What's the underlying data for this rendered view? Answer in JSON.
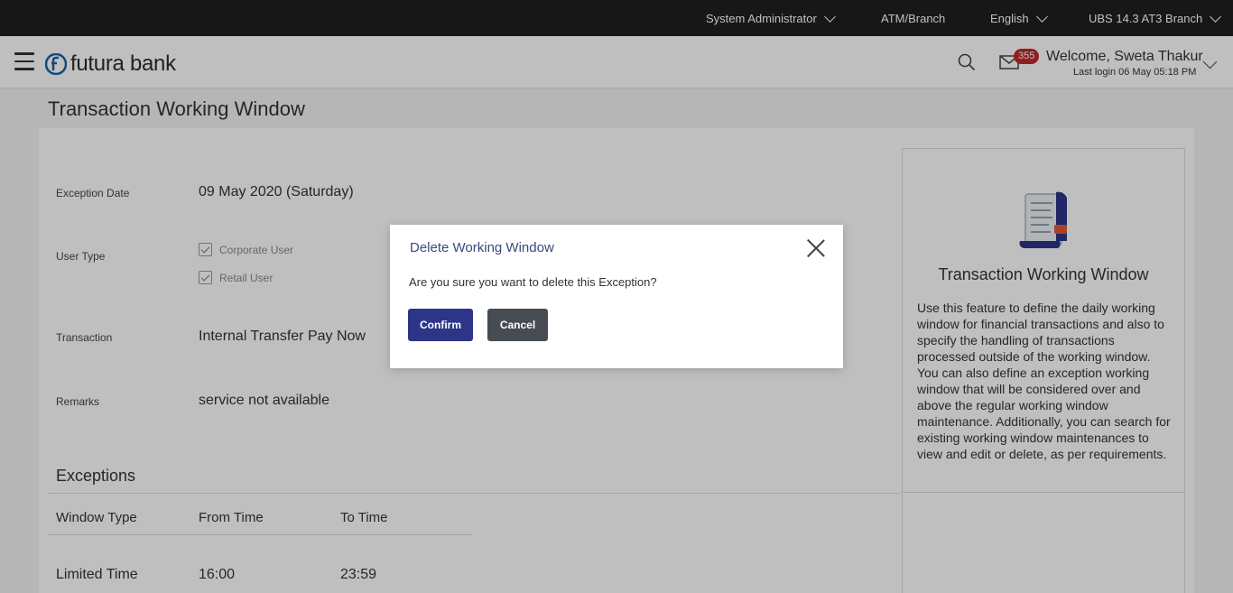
{
  "topbar": {
    "role": "System Administrator",
    "location": "ATM/Branch",
    "language": "English",
    "branch": "UBS 14.3 AT3 Branch"
  },
  "header": {
    "logo_text": "futura bank",
    "mail_count": "355",
    "welcome": "Welcome, Sweta Thakur",
    "last_login": "Last login 06 May 05:18 PM"
  },
  "page": {
    "title": "Transaction Working Window"
  },
  "form": {
    "exception_date_label": "Exception Date",
    "exception_date_value": "09 May 2020 (Saturday)",
    "user_type_label": "User Type",
    "user_types": [
      "Corporate User",
      "Retail User"
    ],
    "transaction_label": "Transaction",
    "transaction_value": "Internal Transfer Pay Now",
    "remarks_label": "Remarks",
    "remarks_value": "service not available"
  },
  "exceptions": {
    "title": "Exceptions",
    "headers": [
      "Window Type",
      "From Time",
      "To Time"
    ],
    "rows": [
      [
        "Limited Time",
        "16:00",
        "23:59"
      ]
    ]
  },
  "help": {
    "title": "Transaction Working Window",
    "description": "Use this feature to define the daily working window for financial transactions and also to specify the handling of transactions processed outside of the working window. You can also define an exception working window that will be considered over and above the regular working window maintenance. Additionally, you can search for existing working window maintenances to view and edit or delete, as per requirements."
  },
  "modal": {
    "title": "Delete Working Window",
    "message": "Are you sure you want to delete this Exception?",
    "confirm_label": "Confirm",
    "cancel_label": "Cancel"
  },
  "colors": {
    "topbar_bg": "#1f1f1f",
    "confirm_bg": "#2d3589",
    "cancel_bg": "#474b52",
    "badge_bg": "#c0272d",
    "modal_title": "#3b4a7a"
  }
}
